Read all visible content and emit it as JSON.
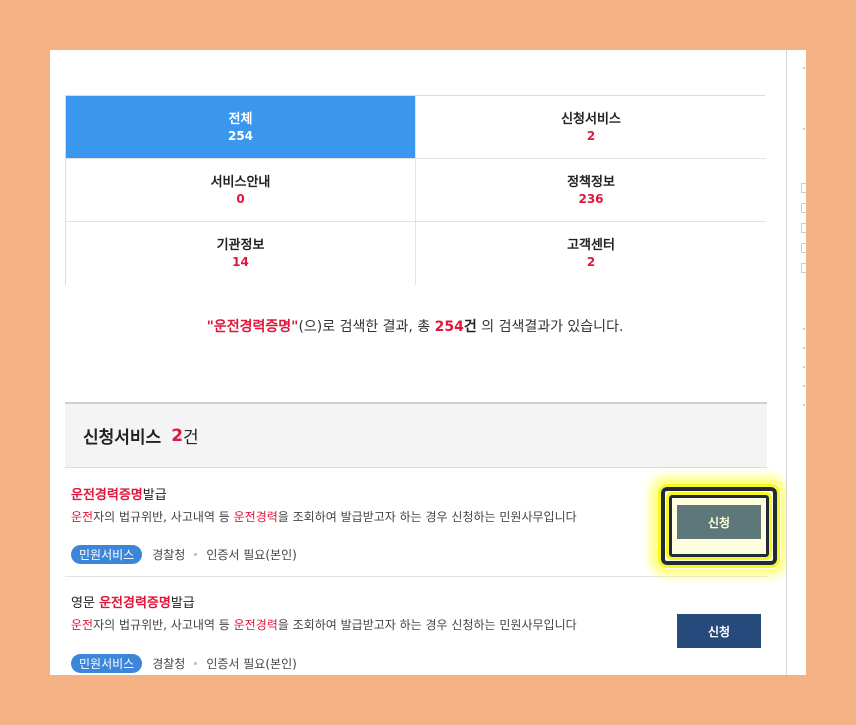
{
  "tabs": [
    {
      "label": "전체",
      "count": "254"
    },
    {
      "label": "신청서비스",
      "count": "2"
    },
    {
      "label": "서비스안내",
      "count": "0"
    },
    {
      "label": "정책정보",
      "count": "236"
    },
    {
      "label": "기관정보",
      "count": "14"
    },
    {
      "label": "고객센터",
      "count": "2"
    }
  ],
  "summary": {
    "keyword": "\"운전경력증명\"",
    "suffix1": "(으)로 검색한 결과, 총 ",
    "total": "254",
    "unit": "건",
    "suffix2": " 의 검색결과가 있습니다."
  },
  "section": {
    "title": "신청서비스",
    "count": "2",
    "unit": "건"
  },
  "items": [
    {
      "title_hl": "운전경력증명",
      "title_rest": "발급",
      "desc_a": "운전",
      "desc_b": "자의 법규위반, 사고내역 등 ",
      "desc_c": "운전경력",
      "desc_d": "을 조회하여 발급받고자 하는 경우 신청하는 민원사무입니다",
      "badge": "민원서비스",
      "agency": "경찰청",
      "requirement": "인증서 필요(본인)",
      "button": "신청"
    },
    {
      "title_pre": "영문 ",
      "title_hl": "운전경력증명",
      "title_rest": "발급",
      "desc_a": "운전",
      "desc_b": "자의 법규위반, 사고내역 등 ",
      "desc_c": "운전경력",
      "desc_d": "을 조회하여 발급받고자 하는 경우 신청하는 민원사무입니다",
      "badge": "민원서비스",
      "agency": "경찰청",
      "requirement": "인증서 필요(본인)",
      "button": "신청"
    }
  ],
  "colors": {
    "accent": "#3b97ee",
    "highlight": "#e0163b",
    "button": "#274a7c",
    "frame": "#f4b183"
  }
}
